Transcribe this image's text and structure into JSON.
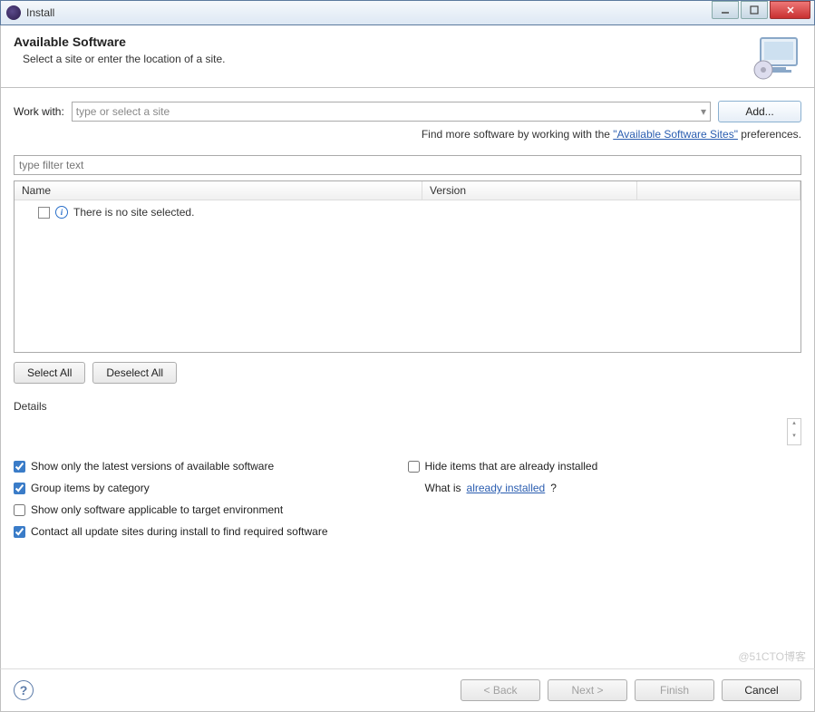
{
  "window": {
    "title": "Install"
  },
  "header": {
    "title": "Available Software",
    "subtitle": "Select a site or enter the location of a site."
  },
  "workwith": {
    "label": "Work with:",
    "placeholder": "type or select a site",
    "add_label": "Add..."
  },
  "findmore": {
    "prefix": "Find more software by working with the ",
    "link": "\"Available Software Sites\"",
    "suffix": " preferences."
  },
  "filter": {
    "placeholder": "type filter text"
  },
  "tree": {
    "columns": {
      "name": "Name",
      "version": "Version"
    },
    "empty_msg": "There is no site selected."
  },
  "buttons": {
    "select_all": "Select All",
    "deselect_all": "Deselect All"
  },
  "details_label": "Details",
  "checks": {
    "latest": "Show only the latest versions of available software",
    "group": "Group items by category",
    "applicable": "Show only software applicable to target environment",
    "contact": "Contact all update sites during install to find required software",
    "hide": "Hide items that are already installed",
    "whatis_prefix": "What is ",
    "whatis_link": "already installed",
    "whatis_suffix": "?"
  },
  "footer": {
    "back": "< Back",
    "next": "Next >",
    "finish": "Finish",
    "cancel": "Cancel"
  },
  "watermark": "@51CTO博客"
}
